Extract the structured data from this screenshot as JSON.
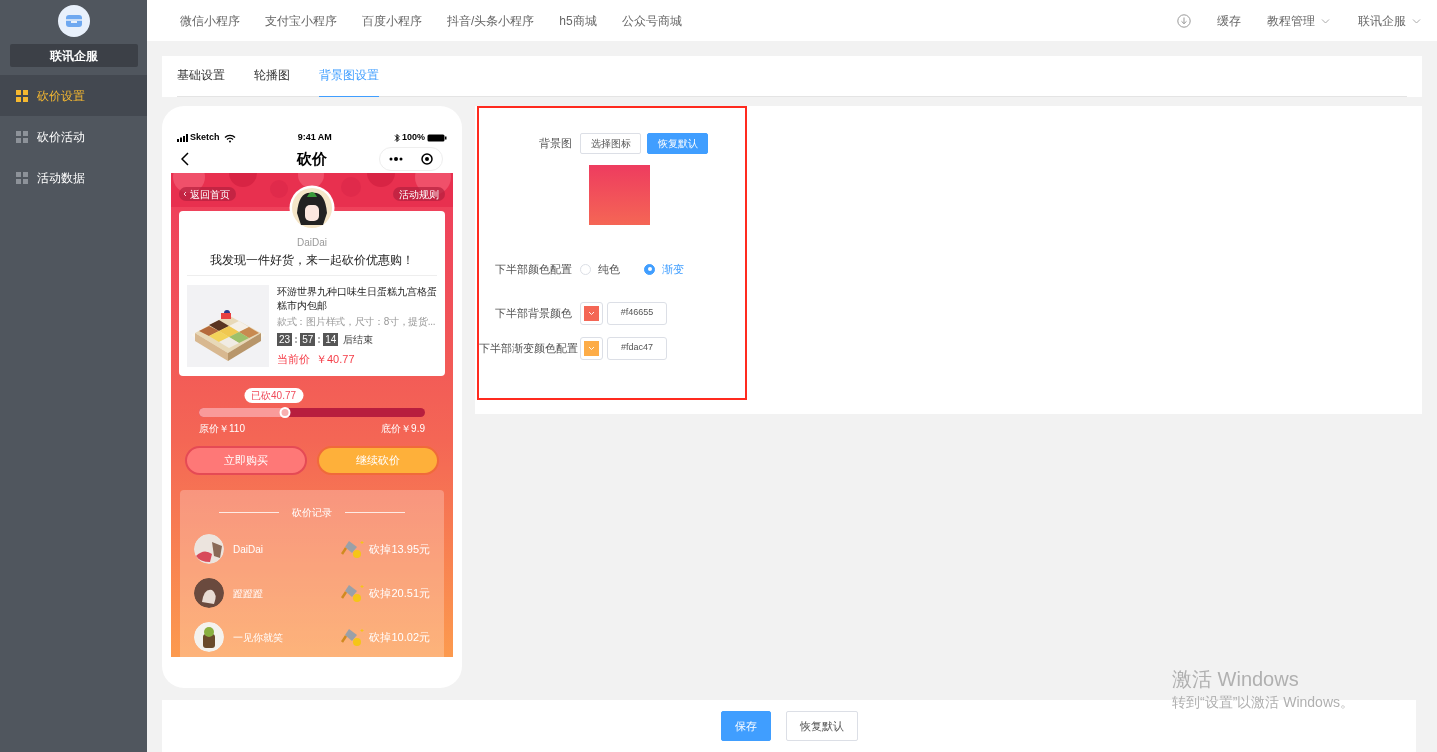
{
  "sidebar": {
    "brand": "联讯企服",
    "items": [
      {
        "label": "砍价设置",
        "selected": true
      },
      {
        "label": "砍价活动",
        "selected": false
      },
      {
        "label": "活动数据",
        "selected": false
      }
    ]
  },
  "top_nav": {
    "links": [
      "微信小程序",
      "支付宝小程序",
      "百度小程序",
      "抖音/头条小程序",
      "h5商城",
      "公众号商城"
    ],
    "cache": "缓存",
    "menus": [
      "教程管理",
      "联讯企服"
    ]
  },
  "tabs": [
    {
      "label": "基础设置",
      "selected": false
    },
    {
      "label": "轮播图",
      "selected": false
    },
    {
      "label": "背景图设置",
      "selected": true
    }
  ],
  "phone": {
    "status": {
      "carrier": "Sketch",
      "time": "9:41 AM",
      "battery": "100%"
    },
    "title": "砍价",
    "back_home": "返回首页",
    "rules": "活动规则",
    "user": "DaiDai",
    "slogan": "我发现一件好货，来一起砍价优惠购！",
    "product": {
      "name": "环游世界九种口味生日蛋糕九宫格蛋糕市内包邮",
      "spec": "款式：图片样式，尺寸：8寸，提货...",
      "countdown": [
        "23",
        "57",
        "14"
      ],
      "countdown_suffix": "后结束",
      "price_label": "当前价",
      "price": "￥40.77"
    },
    "progress": {
      "badge": "已砍40.77",
      "level": 0.38,
      "original": "原价￥110",
      "floor": "底价￥9.9"
    },
    "buttons": [
      {
        "label": "立即购买",
        "kind": "buy"
      },
      {
        "label": "继续砍价",
        "kind": "bargain"
      }
    ],
    "records": {
      "title": "砍价记录",
      "rows": [
        {
          "name": "DaiDai",
          "amount": "砍掉13.95元"
        },
        {
          "name": "蹬蹬蹬",
          "amount": "砍掉20.51元"
        },
        {
          "name": "一见你就笑",
          "amount": "砍掉10.02元"
        }
      ]
    }
  },
  "form": {
    "background": {
      "label": "背景图",
      "buttons": [
        {
          "label": "选择图标",
          "kind": "default"
        },
        {
          "label": "恢复默认",
          "kind": "primary"
        }
      ]
    },
    "color_mode": {
      "label": "下半部颜色配置",
      "options": [
        {
          "label": "纯色",
          "selected": false
        },
        {
          "label": "渐变",
          "selected": true
        }
      ]
    },
    "colors": [
      {
        "label": "下半部背景颜色",
        "color": "#f46655",
        "value": "#f46655"
      },
      {
        "label": "下半部渐变颜色配置",
        "color": "#fdac47",
        "value": "#fdac47"
      }
    ]
  },
  "footer_buttons": [
    {
      "label": "保存",
      "kind": "primary"
    },
    {
      "label": "恢复默认",
      "kind": "default"
    }
  ],
  "os_notice": {
    "title": "激活 Windows",
    "text": "转到“设置”以激活 Windows。"
  }
}
